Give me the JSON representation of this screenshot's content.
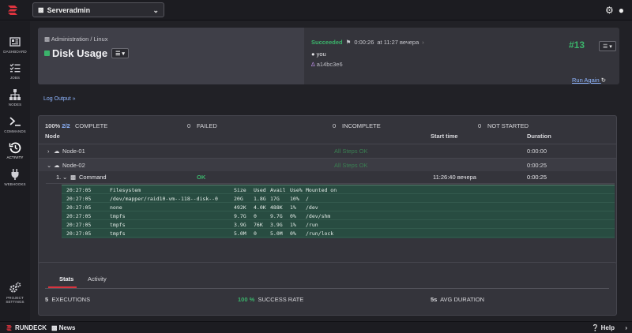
{
  "app": {
    "project": "Serveradmin",
    "footer_brand": "RUNDECK",
    "footer_news": "News",
    "footer_help": "Help"
  },
  "sidebar": {
    "items": [
      {
        "label": "DASHBOARD",
        "icon": "dashboard-icon"
      },
      {
        "label": "JOBS",
        "icon": "jobs-icon"
      },
      {
        "label": "NODES",
        "icon": "nodes-icon"
      },
      {
        "label": "COMMANDS",
        "icon": "terminal-icon"
      },
      {
        "label": "ACTIVITY",
        "icon": "history-icon"
      },
      {
        "label": "WEBHOOKS",
        "icon": "plug-icon"
      },
      {
        "label": "PROJECT SETTINGS",
        "icon": "gears-icon"
      }
    ]
  },
  "job": {
    "breadcrumb": "Administration / Linux",
    "title": "Disk Usage"
  },
  "execution": {
    "status": "Succeeded",
    "duration": "0:00:26",
    "at_text": "at 11:27 вечера",
    "user": "you",
    "hash": "a14bc3e6",
    "number": "#13",
    "run_again": "Run Again"
  },
  "log_output_link": "Log Output »",
  "summary": {
    "complete_pct": "100%",
    "complete_frac": "2/2",
    "complete_label": "COMPLETE",
    "failed_count": "0",
    "failed_label": "FAILED",
    "incomplete_count": "0",
    "incomplete_label": "INCOMPLETE",
    "not_started_count": "0",
    "not_started_label": "NOT STARTED"
  },
  "table_headers": {
    "node": "Node",
    "start_time": "Start time",
    "duration": "Duration"
  },
  "nodes": [
    {
      "name": "Node-01",
      "status": "All Steps OK",
      "duration": "0:00:00"
    },
    {
      "name": "Node-02",
      "status": "All Steps OK",
      "duration": "0:00:25"
    }
  ],
  "command_step": {
    "index": "1.",
    "name": "Command",
    "status": "OK",
    "start_time": "11:26:40 вечера",
    "duration": "0:00:25"
  },
  "log_lines": [
    {
      "time": "20:27:05",
      "fs": "Filesystem",
      "size": "Size",
      "used": "Used",
      "avail": "Avail",
      "use": "Use%",
      "mount": "Mounted on"
    },
    {
      "time": "20:27:05",
      "fs": "/dev/mapper/raid10-vm--118--disk--0",
      "size": "20G",
      "used": "1.8G",
      "avail": "17G",
      "use": "10%",
      "mount": "/"
    },
    {
      "time": "20:27:05",
      "fs": "none",
      "size": "492K",
      "used": "4.0K",
      "avail": "488K",
      "use": "1%",
      "mount": "/dev"
    },
    {
      "time": "20:27:05",
      "fs": "tmpfs",
      "size": "9.7G",
      "used": "0",
      "avail": "9.7G",
      "use": "0%",
      "mount": "/dev/shm"
    },
    {
      "time": "20:27:05",
      "fs": "tmpfs",
      "size": "3.9G",
      "used": "76K",
      "avail": "3.9G",
      "use": "1%",
      "mount": "/run"
    },
    {
      "time": "20:27:05",
      "fs": "tmpfs",
      "size": "5.0M",
      "used": "0",
      "avail": "5.0M",
      "use": "0%",
      "mount": "/run/lock"
    }
  ],
  "stats": {
    "tabs": [
      "Stats",
      "Activity"
    ],
    "executions_count": "5",
    "executions_label": "EXECUTIONS",
    "success_rate": "100 %",
    "success_label": "SUCCESS RATE",
    "avg_duration": "5s",
    "avg_label": "AVG DURATION"
  },
  "colors": {
    "success": "#3bb36b",
    "link": "#8fb6ff",
    "brand": "#d8343f",
    "log_bg": "#284c41"
  }
}
